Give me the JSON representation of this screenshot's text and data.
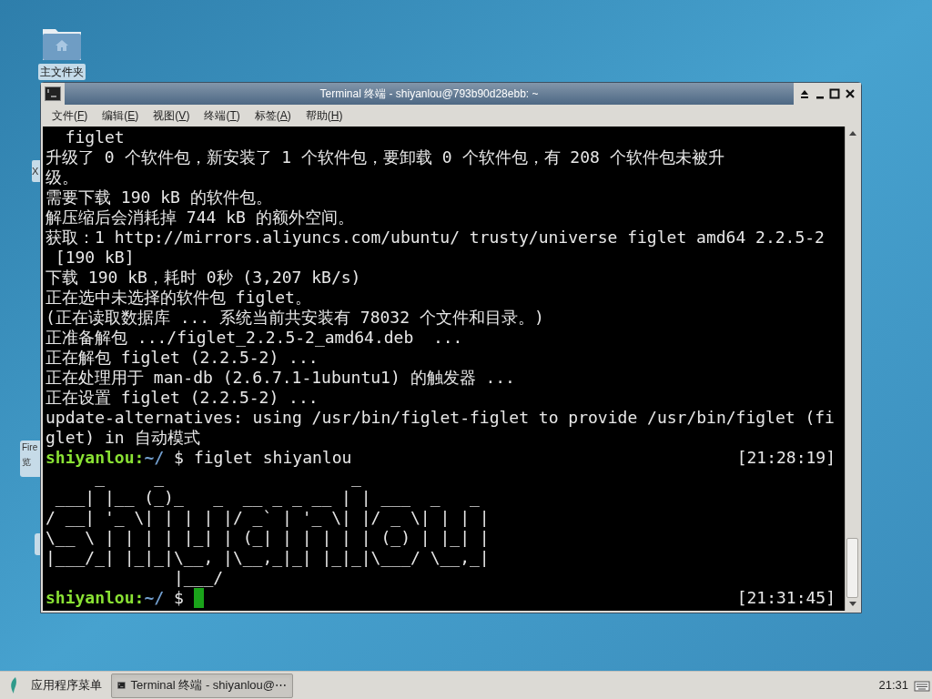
{
  "desktop": {
    "icons": [
      {
        "kind": "folder",
        "label": "主文件夹",
        "selected": true
      },
      {
        "kind": "cut",
        "label": "X",
        "selected": false
      },
      {
        "kind": "cut2",
        "label": "Fire",
        "label2": "览",
        "selected": false
      },
      {
        "kind": "cut3",
        "selected": false
      }
    ]
  },
  "window": {
    "title": "Terminal 终端 - shiyanlou@793b90d28ebb: ~",
    "menu": [
      {
        "before": "文件(",
        "accel": "F",
        "after": ")"
      },
      {
        "before": "编辑(",
        "accel": "E",
        "after": ")"
      },
      {
        "before": "视图(",
        "accel": "V",
        "after": ")"
      },
      {
        "before": "终端(",
        "accel": "T",
        "after": ")"
      },
      {
        "before": "标签(",
        "accel": "A",
        "after": ")"
      },
      {
        "before": "帮助(",
        "accel": "H",
        "after": ")"
      }
    ],
    "terminal": {
      "lines": [
        {
          "kind": "text",
          "text": "  figlet"
        },
        {
          "kind": "text",
          "text": "升级了 0 个软件包，新安装了 1 个软件包，要卸载 0 个软件包，有 208 个软件包未被升"
        },
        {
          "kind": "text",
          "text": "级。"
        },
        {
          "kind": "text",
          "text": "需要下载 190 kB 的软件包。"
        },
        {
          "kind": "text",
          "text": "解压缩后会消耗掉 744 kB 的额外空间。"
        },
        {
          "kind": "text",
          "text": "获取：1 http://mirrors.aliyuncs.com/ubuntu/ trusty/universe figlet amd64 2.2.5-2"
        },
        {
          "kind": "text",
          "text": " [190 kB]"
        },
        {
          "kind": "text",
          "text": "下载 190 kB，耗时 0秒 (3,207 kB/s)"
        },
        {
          "kind": "text",
          "text": "正在选中未选择的软件包 figlet。"
        },
        {
          "kind": "text",
          "text": "(正在读取数据库 ... 系统当前共安装有 78032 个文件和目录。)"
        },
        {
          "kind": "text",
          "text": "正准备解包 .../figlet_2.2.5-2_amd64.deb  ..."
        },
        {
          "kind": "text",
          "text": "正在解包 figlet (2.2.5-2) ..."
        },
        {
          "kind": "text",
          "text": "正在处理用于 man-db (2.6.7.1-1ubuntu1) 的触发器 ..."
        },
        {
          "kind": "text",
          "text": "正在设置 figlet (2.2.5-2) ..."
        },
        {
          "kind": "text",
          "text": "update-alternatives: using /usr/bin/figlet-figlet to provide /usr/bin/figlet (fi"
        },
        {
          "kind": "text",
          "text": "glet) in 自动模式"
        },
        {
          "kind": "prompt",
          "user": "shiyanlou",
          "sep": ":",
          "path": "~/",
          "sign": "$",
          "command": "figlet shiyanlou",
          "time": "[21:28:19]",
          "cursor": false
        },
        {
          "kind": "art",
          "text": "     _     _                   _"
        },
        {
          "kind": "art",
          "text": " ___| |__ (_)_   _  __ _ _ __ | | ___  _   _"
        },
        {
          "kind": "art",
          "text": "/ __| '_ \\| | | | |/ _` | '_ \\| |/ _ \\| | | |"
        },
        {
          "kind": "art",
          "text": "\\__ \\ | | | | |_| | (_| | | | | | (_) | |_| |"
        },
        {
          "kind": "art",
          "text": "|___/_| |_|_|\\__, |\\__,_|_| |_|_|\\___/ \\__,_|"
        },
        {
          "kind": "art",
          "text": "             |___/"
        },
        {
          "kind": "prompt",
          "user": "shiyanlou",
          "sep": ":",
          "path": "~/",
          "sign": "$",
          "time": "[21:31:45]",
          "cursor": true
        }
      ]
    }
  },
  "taskbar": {
    "menu_label": "应用程序菜单",
    "task": {
      "label": "Terminal 终端 - shiyanlou@⋯",
      "selected": true
    },
    "clock": "21:31"
  }
}
